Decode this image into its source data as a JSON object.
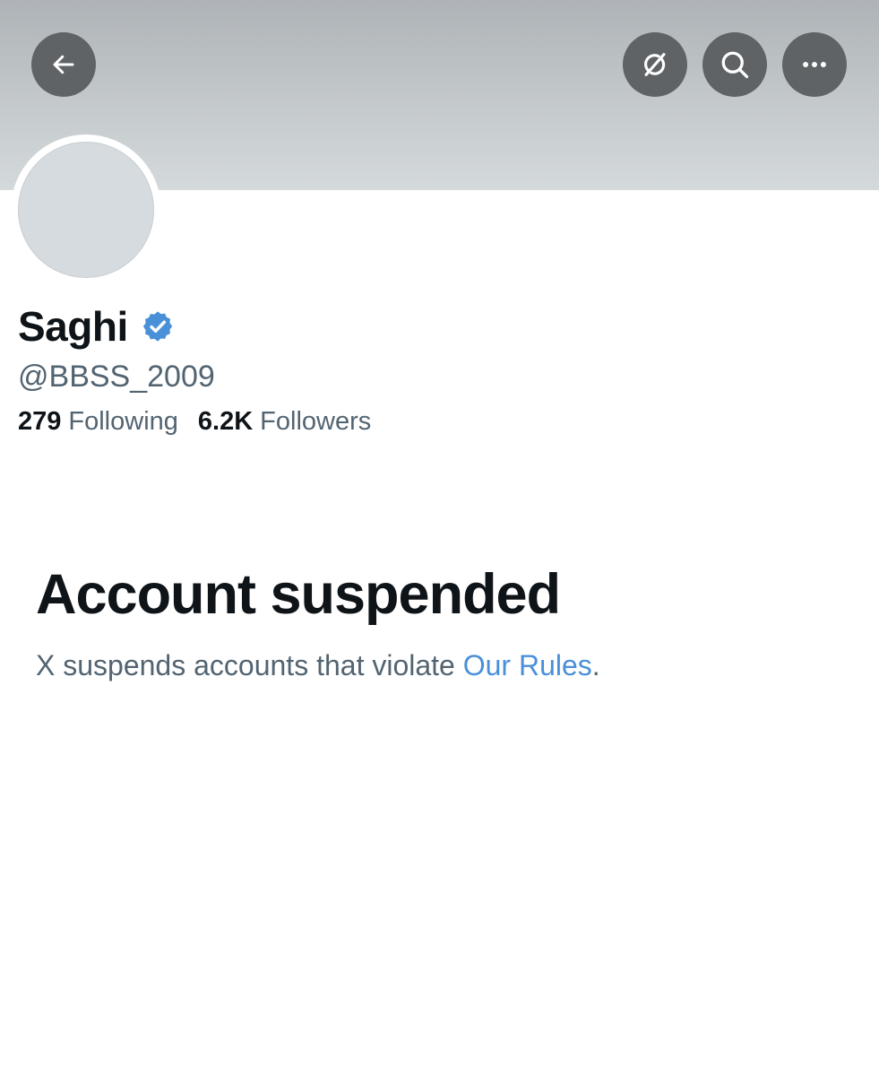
{
  "header": {
    "back_icon": "arrow-left-icon",
    "translate_icon": "no-translate-icon",
    "search_icon": "search-icon",
    "more_icon": "more-horizontal-icon",
    "button_bg": "#5f6366"
  },
  "profile": {
    "name": "Saghi",
    "verified_icon": "verified-badge-icon",
    "verified_color": "#4a90d9",
    "handle": "@BBSS_2009",
    "following_count": "279",
    "following_label": "Following",
    "followers_count": "6.2K",
    "followers_label": "Followers"
  },
  "notice": {
    "title": "Account suspended",
    "text_prefix": "X suspends accounts that violate ",
    "link_text": "Our Rules",
    "text_suffix": ".",
    "link_color": "#4a90d9"
  }
}
